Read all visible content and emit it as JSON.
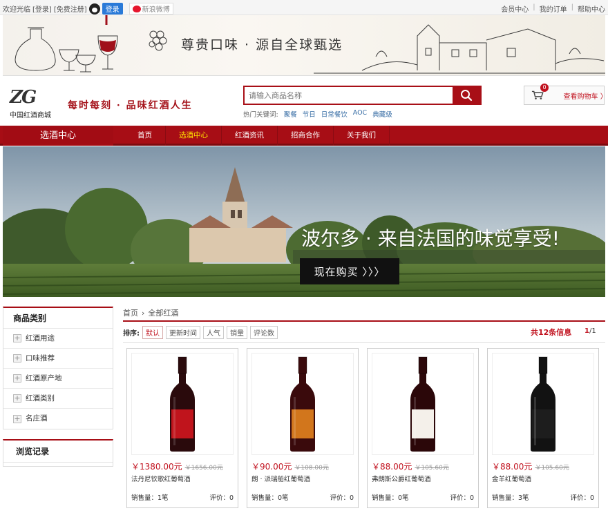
{
  "topbar": {
    "welcome": "欢迎光临",
    "login_link": "[登录]",
    "register_link": "[免费注册]",
    "qq_login": "登录",
    "weibo": "新浪微博",
    "links": [
      "会员中心",
      "我的订单",
      "帮助中心"
    ]
  },
  "header": {
    "banner_slogan": "尊贵口味 · 源自全球甄选",
    "logo_mark": "ZG",
    "logo_name": "中国红酒商城",
    "tagline": "每时每刻 · 品味红酒人生",
    "search_placeholder": "请输入商品名称",
    "hot_label": "热门关键词:",
    "hot_keywords": [
      "聚餐",
      "节日",
      "日常餐饮",
      "AOC",
      "典藏级"
    ],
    "cart_count": "0",
    "cart_label": "查看购物车 〉"
  },
  "nav": {
    "category_center": "选酒中心",
    "links": [
      {
        "label": "首页",
        "active": false
      },
      {
        "label": "选酒中心",
        "active": true
      },
      {
        "label": "红酒资讯",
        "active": false
      },
      {
        "label": "招商合作",
        "active": false
      },
      {
        "label": "关于我们",
        "active": false
      }
    ]
  },
  "hero": {
    "title": "波尔多 · 来自法国的味觉享受!",
    "buy_button": "现在购买 〉〉〉"
  },
  "sidebar": {
    "category_title": "商品类别",
    "categories": [
      "红酒用途",
      "口味推荐",
      "红酒原产地",
      "红酒类别",
      "名庄酒"
    ],
    "history_title": "浏览记录"
  },
  "main": {
    "breadcrumb": [
      "首页",
      "全部红酒"
    ],
    "sort_label": "排序:",
    "sort_options": [
      {
        "label": "默认",
        "active": true
      },
      {
        "label": "更新时间",
        "active": false
      },
      {
        "label": "人气",
        "active": false
      },
      {
        "label": "销量",
        "active": false
      },
      {
        "label": "评论数",
        "active": false
      }
    ],
    "total": "共12条信息",
    "page_current": "1",
    "page_total": "/1"
  },
  "products": [
    {
      "price": "￥1380.00元",
      "old_price": "￥1656.00元",
      "name": "法丹尼钦歌红葡萄酒",
      "sales": "销售量：1笔",
      "reviews": "评价：0",
      "bottle_color": "#2a0a0c",
      "label_color": "#c0141c"
    },
    {
      "price": "￥90.00元",
      "old_price": "￥108.00元",
      "name": "朗 · 派瑞船红葡萄酒",
      "sales": "销售量：0笔",
      "reviews": "评价：0",
      "bottle_color": "#3a0a0c",
      "label_color": "#d2761c"
    },
    {
      "price": "￥88.00元",
      "old_price": "￥105.60元",
      "name": "弗朗斯公爵红葡萄酒",
      "sales": "销售量：0笔",
      "reviews": "评价：0",
      "bottle_color": "#2b0709",
      "label_color": "#f4f0ea"
    },
    {
      "price": "￥88.00元",
      "old_price": "￥105.60元",
      "name": "金羊红葡萄酒",
      "sales": "销售量：3笔",
      "reviews": "评价：0",
      "bottle_color": "#121212",
      "label_color": "#1d1d1d"
    }
  ]
}
